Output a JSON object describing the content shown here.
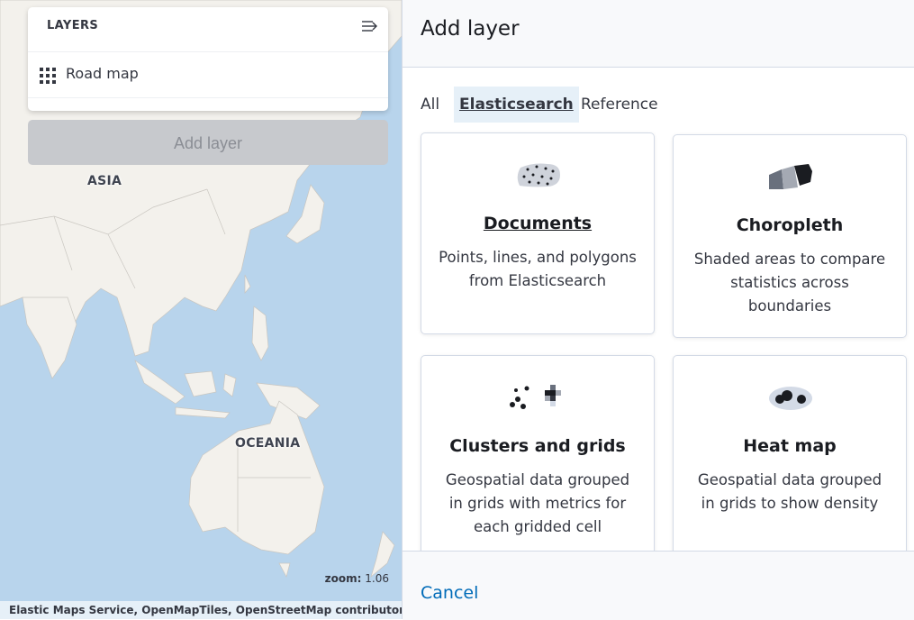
{
  "map": {
    "region_labels": {
      "asia": "ASIA",
      "oceania": "OCEANIA"
    },
    "zoom_label": "zoom:",
    "zoom_value": "1.06",
    "attribution": "Elastic Maps Service, OpenMapTiles, OpenStreetMap contributors",
    "colors": {
      "water": "#b8d4ec",
      "land": "#f3f1ec",
      "border": "#c9c6c0"
    }
  },
  "layers_panel": {
    "title": "LAYERS",
    "collapse_icon": "collapse-right-icon",
    "layers": [
      {
        "name": "Road map",
        "icon": "grid-icon"
      }
    ],
    "add_layer_label": "Add layer"
  },
  "flyout": {
    "title": "Add layer",
    "tabs": [
      {
        "label": "All",
        "active": false
      },
      {
        "label": "Elasticsearch",
        "active": true
      },
      {
        "label": "Reference",
        "active": false
      }
    ],
    "cards": [
      {
        "title": "Documents",
        "description": "Points, lines, and polygons from Elasticsearch",
        "icon": "documents-icon"
      },
      {
        "title": "Choropleth",
        "description": "Shaded areas to compare statistics across boundaries",
        "icon": "choropleth-icon"
      },
      {
        "title": "Clusters and grids",
        "description": "Geospatial data grouped in grids with metrics for each gridded cell",
        "icon": "clusters-grids-icon"
      },
      {
        "title": "Heat map",
        "description": "Geospatial data grouped in grids to show density",
        "icon": "heatmap-icon"
      }
    ],
    "cancel_label": "Cancel",
    "colors": {
      "link": "#006bb8",
      "tab_active_bg": "#e6f0f8"
    }
  }
}
